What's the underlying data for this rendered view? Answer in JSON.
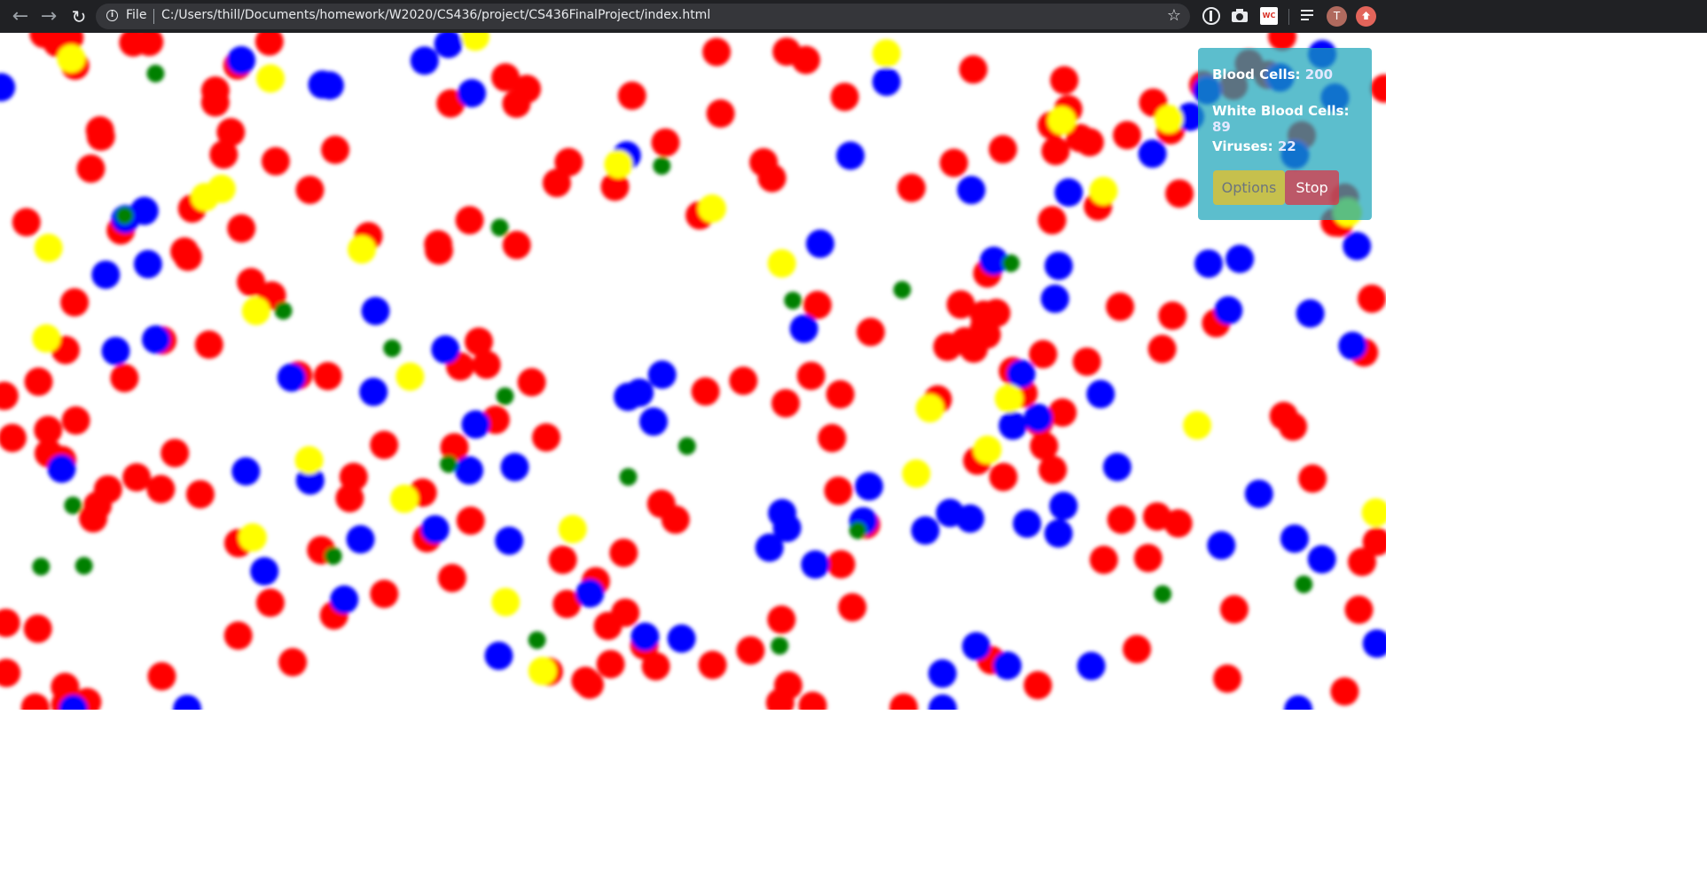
{
  "browser": {
    "url_scheme": "File",
    "url": "C:/Users/thill/Documents/homework/W2020/CS436/project/CS436FinalProject/index.html",
    "profile_initial": "T",
    "extension_badge": "WC"
  },
  "stats": {
    "blood_cells_label": "Blood Cells:",
    "blood_cells_value": "200",
    "white_blood_cells_label": "White Blood Cells:",
    "white_blood_cells_value": "89",
    "viruses_label": "Viruses:",
    "viruses_value": "22"
  },
  "controls": {
    "options_label": "Options",
    "stop_label": "Stop"
  },
  "colors": {
    "red_blood_cell": "#ff0000",
    "white_blood_cell": "#0000ff",
    "virus": "#008000",
    "other_cell": "#ffff00",
    "panel": "#17a2b8"
  }
}
